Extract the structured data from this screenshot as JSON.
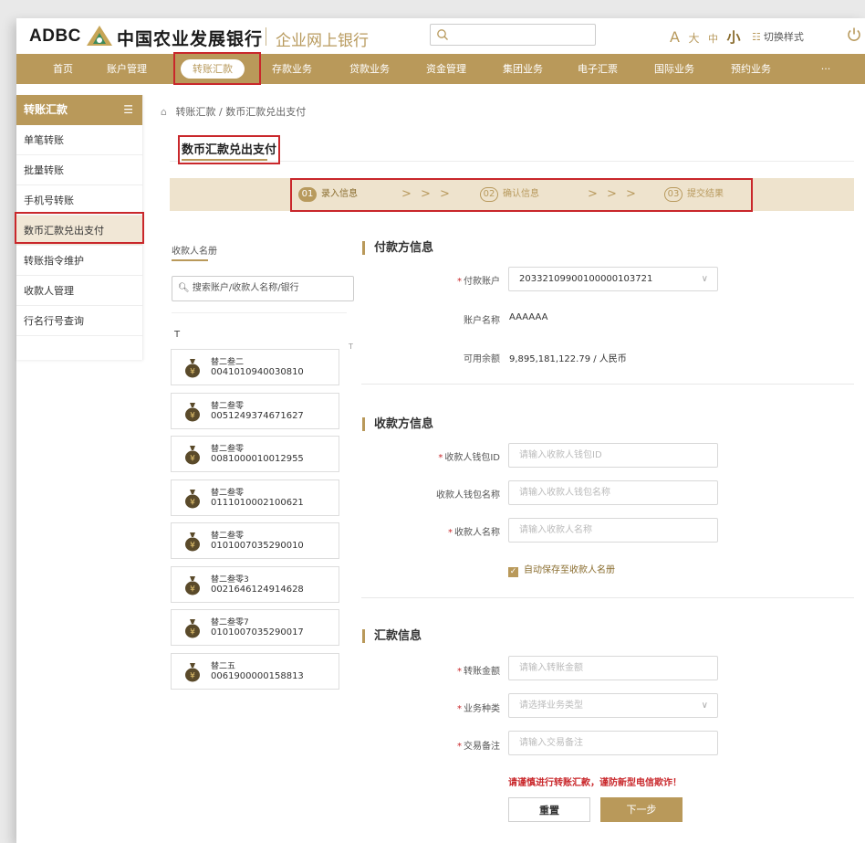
{
  "header": {
    "logo_en": "ADBC",
    "logo_cn": "中国农业发展银行",
    "logo_sub": "企业网上银行",
    "font_size_icon": "A",
    "font_large": "大",
    "font_medium": "中",
    "font_small": "小",
    "switch_style": "切换样式"
  },
  "nav": {
    "items": [
      "首页",
      "账户管理",
      "转账汇款",
      "存款业务",
      "贷款业务",
      "资金管理",
      "集团业务",
      "电子汇票",
      "国际业务",
      "预约业务",
      "···"
    ],
    "active_index": 2
  },
  "sidebar": {
    "title": "转账汇款",
    "items": [
      "单笔转账",
      "批量转账",
      "手机号转账",
      "数币汇款兑出支付",
      "转账指令维护",
      "收款人管理",
      "行名行号查询"
    ],
    "active_index": 3
  },
  "breadcrumb": [
    "转账汇款",
    "/",
    "数币汇款兑出支付"
  ],
  "page_title": "数币汇款兑出支付",
  "steps": [
    {
      "num": "01",
      "label": "录入信息"
    },
    {
      "num": "02",
      "label": "确认信息"
    },
    {
      "num": "03",
      "label": "提交结果"
    }
  ],
  "step_arrow": "> > >",
  "payee_panel": {
    "tab": "收款人名册",
    "search_placeholder": "搜索账户/收款人名称/银行",
    "letter": "T",
    "index_letter": "T",
    "payees": [
      {
        "name": "替二叁二",
        "account": "0041010940030810"
      },
      {
        "name": "替二叁零",
        "account": "0051249374671627"
      },
      {
        "name": "替二叁零",
        "account": "0081000010012955"
      },
      {
        "name": "替二叁零",
        "account": "0111010002100621"
      },
      {
        "name": "替二叁零",
        "account": "0101007035290010"
      },
      {
        "name": "替二叁零3",
        "account": "0021646124914628"
      },
      {
        "name": "替二叁零7",
        "account": "0101007035290017"
      },
      {
        "name": "替二五",
        "account": "0061900000158813"
      }
    ]
  },
  "payer": {
    "section_title": "付款方信息",
    "account_label": "付款账户",
    "account_value": "20332109900100000103721",
    "name_label": "账户名称",
    "name_value": "AAAAAA",
    "balance_label": "可用余额",
    "balance_value": "9,895,181,122.79 / 人民币"
  },
  "payee": {
    "section_title": "收款方信息",
    "wallet_id_label": "收款人钱包ID",
    "wallet_id_placeholder": "请输入收款人钱包ID",
    "wallet_name_label": "收款人钱包名称",
    "wallet_name_placeholder": "请输入收款人钱包名称",
    "name_label": "收款人名称",
    "name_placeholder": "请输入收款人名称",
    "auto_save_label": "自动保存至收款人名册",
    "auto_save_checked": true
  },
  "remit": {
    "section_title": "汇款信息",
    "amount_label": "转账金额",
    "amount_placeholder": "请输入转账金额",
    "type_label": "业务种类",
    "type_placeholder": "请选择业务类型",
    "memo_label": "交易备注",
    "memo_placeholder": "请输入交易备注"
  },
  "warning": "请谨慎进行转账汇款，谨防新型电信欺诈！",
  "buttons": {
    "reset": "重置",
    "next": "下一步"
  },
  "colors": {
    "brand": "#b9995a",
    "highlight": "#c9272b",
    "step_bg": "#eee3cd"
  }
}
